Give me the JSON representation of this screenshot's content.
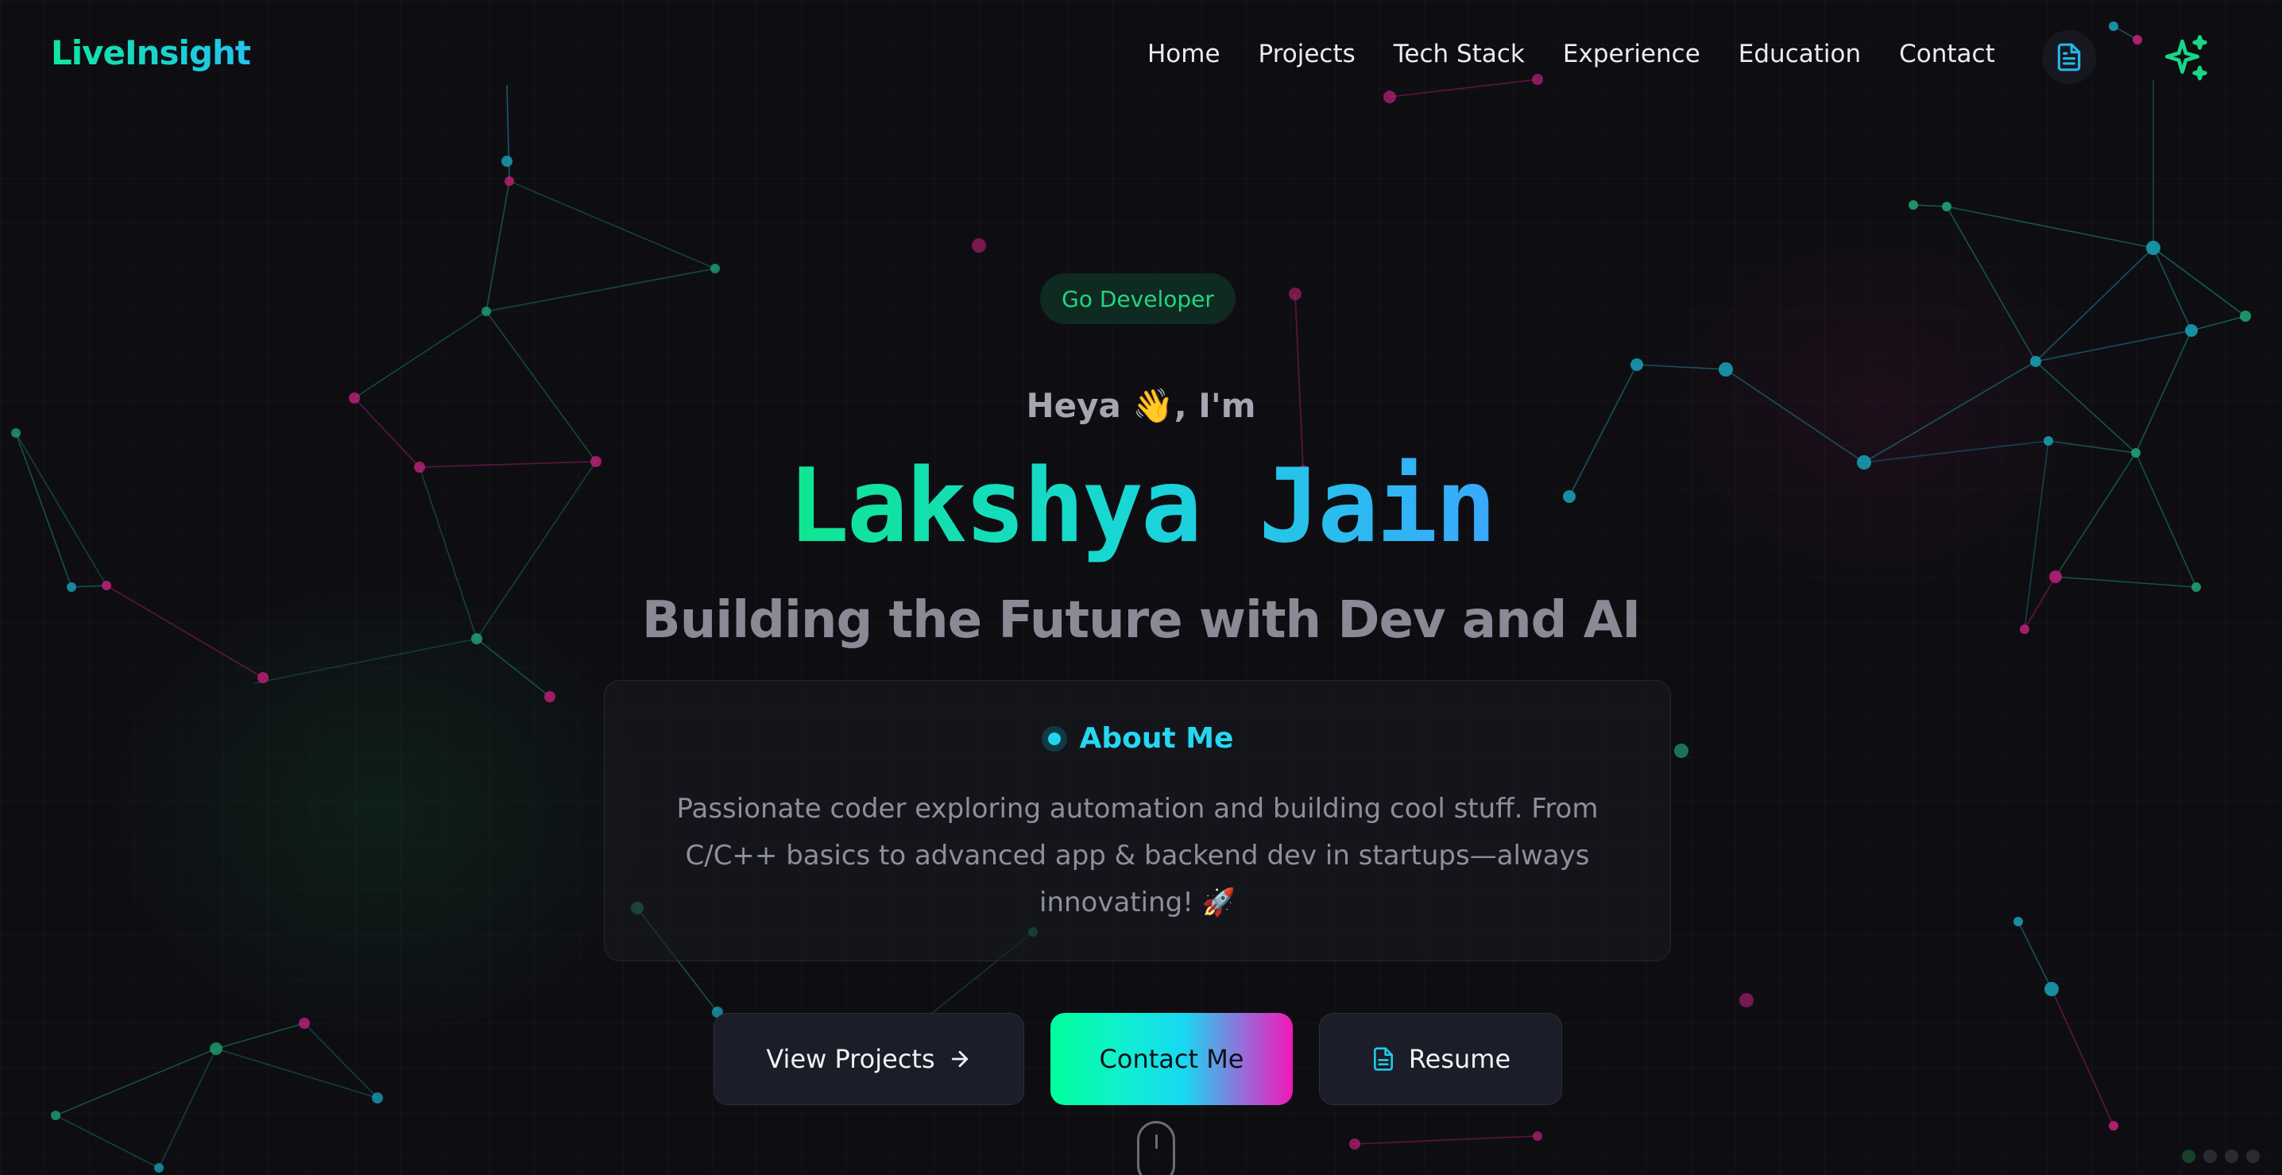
{
  "nav": {
    "logo": "LiveInsight",
    "links": [
      "Home",
      "Projects",
      "Tech Stack",
      "Experience",
      "Education",
      "Contact"
    ],
    "doc_icon": "document-icon",
    "sparkle_icon": "sparkles-icon"
  },
  "hero": {
    "badge": "Go Developer",
    "greeting": "Heya 👋, I'm",
    "name": "Lakshya Jain",
    "tagline": "Building the Future with Dev and AI"
  },
  "about": {
    "title": "About Me",
    "text": "Passionate coder exploring automation and building cool stuff. From C/C++ basics to advanced app & backend dev in startups—always innovating! 🚀"
  },
  "buttons": {
    "projects": "View Projects",
    "contact": "Contact Me",
    "resume": "Resume"
  },
  "colors": {
    "accent_green": "#10e690",
    "accent_cyan": "#1fd6f0",
    "accent_pink": "#f018b8",
    "background": "#0e0e12"
  }
}
